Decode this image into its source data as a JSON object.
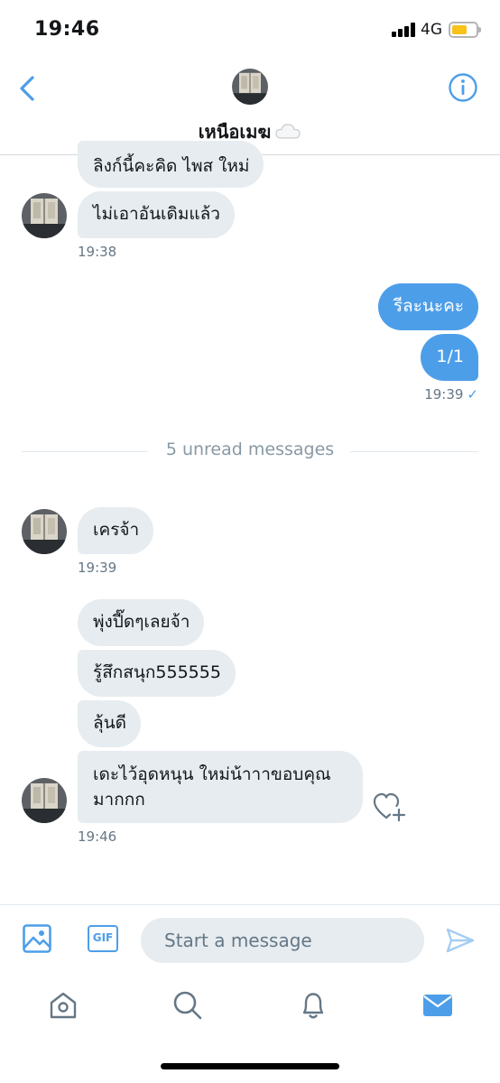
{
  "status_bar": {
    "time": "19:46",
    "network": "4G"
  },
  "header": {
    "name": "เหนือเมฆ"
  },
  "messages": {
    "m1": "ลิงก์นี้คะคิด ไพส ใหม่",
    "m2": "ไม่เอาอันเดิมแล้ว",
    "t1": "19:38",
    "m3": "รีละนะคะ",
    "m4": "1/1",
    "t2": "19:39",
    "m5": "เครจ้า",
    "t3": "19:39",
    "m6": "พุ่งปี๊ดๆเลยจ้า",
    "m7": "รู้สึกสนุก555555",
    "m8": "ลุ้นดี",
    "m9": "เดะไว้อุดหนุน ใหม่น้าาาขอบคุณมากกก",
    "t4": "19:46"
  },
  "divider": {
    "label": "5 unread messages"
  },
  "composer": {
    "placeholder": "Start a message",
    "gif_label": "GIF"
  },
  "colors": {
    "accent": "#4d9ee9",
    "bubble_in": "#e6ecf0",
    "timestamp": "#657786"
  },
  "icons": [
    "back-icon",
    "info-icon",
    "cloud-icon",
    "heart-plus-icon",
    "image-icon",
    "gif-icon",
    "send-icon",
    "home-icon",
    "search-icon",
    "bell-icon",
    "mail-icon"
  ]
}
